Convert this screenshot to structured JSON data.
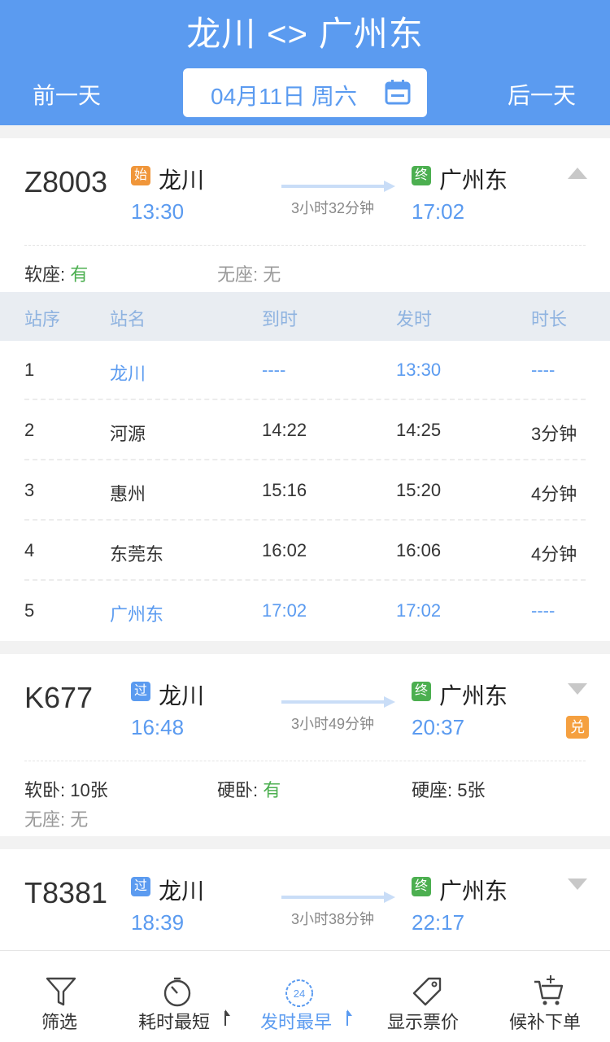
{
  "header": {
    "title": "龙川 <> 广州东",
    "prev_day": "前一天",
    "next_day": "后一天",
    "date": "04月11日 周六"
  },
  "trains": [
    {
      "number": "Z8003",
      "from_badge": "始",
      "from": "龙川",
      "depart": "13:30",
      "duration": "3小时32分钟",
      "to_badge": "终",
      "to": "广州东",
      "arrive": "17:02",
      "expanded": true,
      "seats": [
        {
          "label": "软座:",
          "value": "有"
        },
        {
          "label": "无座:",
          "value": "无"
        }
      ]
    },
    {
      "number": "K677",
      "from_badge": "过",
      "from": "龙川",
      "depart": "16:48",
      "duration": "3小时49分钟",
      "to_badge": "终",
      "to": "广州东",
      "arrive": "20:37",
      "exchange_badge": "兑",
      "seats": [
        {
          "label": "软卧:",
          "value": "10张"
        },
        {
          "label": "硬卧:",
          "value": "有"
        },
        {
          "label": "硬座:",
          "value": "5张"
        },
        {
          "label": "无座:",
          "value": "无"
        }
      ]
    },
    {
      "number": "T8381",
      "from_badge": "过",
      "from": "龙川",
      "depart": "18:39",
      "duration": "3小时38分钟",
      "to_badge": "终",
      "to": "广州东",
      "arrive": "22:17"
    }
  ],
  "stops": {
    "headers": [
      "站序",
      "站名",
      "到时",
      "发时",
      "时长"
    ],
    "rows": [
      [
        "1",
        "龙川",
        "----",
        "13:30",
        "----"
      ],
      [
        "2",
        "河源",
        "14:22",
        "14:25",
        "3分钟"
      ],
      [
        "3",
        "惠州",
        "15:16",
        "15:20",
        "4分钟"
      ],
      [
        "4",
        "东莞东",
        "16:02",
        "16:06",
        "4分钟"
      ],
      [
        "5",
        "广州东",
        "17:02",
        "17:02",
        "----"
      ]
    ]
  },
  "bottom_tabs": [
    {
      "label": "筛选",
      "icon": "filter-icon"
    },
    {
      "label": "耗时最短",
      "icon": "stopwatch-icon"
    },
    {
      "label": "发时最早",
      "icon": "clock-24-icon",
      "active": true
    },
    {
      "label": "显示票价",
      "icon": "price-tag-icon"
    },
    {
      "label": "候补下单",
      "icon": "cart-add-icon"
    }
  ]
}
